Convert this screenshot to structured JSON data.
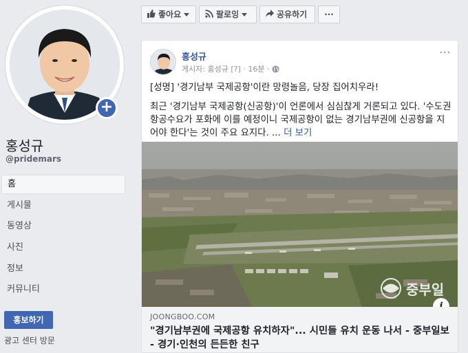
{
  "sidebar": {
    "page_name": "홍성규",
    "page_handle": "@pridemars",
    "nav": [
      {
        "label": "홈",
        "active": true
      },
      {
        "label": "게시물"
      },
      {
        "label": "동영상"
      },
      {
        "label": "사진"
      },
      {
        "label": "정보"
      },
      {
        "label": "커뮤니티"
      }
    ],
    "promote_label": "홍보하기",
    "ad_center_label": "광고 센터 방문"
  },
  "toolbar": {
    "like_label": "좋아요",
    "follow_label": "팔로잉",
    "share_label": "공유하기",
    "more_label": "···"
  },
  "post": {
    "author": "홍성규",
    "meta": "게시자: 홍성규 [?] · 16분 ·",
    "menu_label": "···",
    "headline": "[성명] '경기남부 국제공항'이란 망령놀음, 당장 집어치우라!",
    "body": "최근 '경기남부 국제공항(신공항)'이 언론에서 심심찮게 거론되고 있다. '수도권 항공수요가 포화에 이를 예정이니 국제공항이 없는 경기남부권에 신공항을 지어야 한다'는 것이 주요 요지다. ...",
    "see_more": "더 보기",
    "image_watermark": "중부일",
    "link": {
      "domain": "JOONGBOO.COM",
      "title": "\"경기남부권에 국제공항 유치하자\"... 시민들 유치 운동 나서 - 중부일보 - 경기·인천의 든든한 친구"
    }
  },
  "colors": {
    "brand": "#4267b2",
    "link": "#365899",
    "background": "#e9ebee"
  },
  "icons": [
    "add-icon",
    "thumbs-up-icon",
    "rss-icon",
    "share-arrow-icon",
    "globe-icon",
    "info-icon"
  ]
}
